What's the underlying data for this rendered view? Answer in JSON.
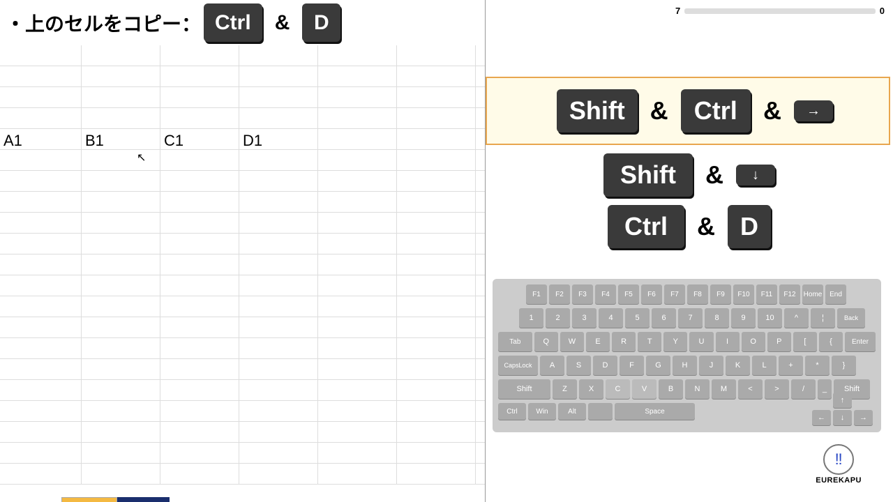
{
  "title": "・上のセルをコピー：",
  "title_keys": {
    "k1": "Ctrl",
    "amp": "&",
    "k2": "D"
  },
  "cells": {
    "a": "A1",
    "b": "B1",
    "c": "C1",
    "d": "D1"
  },
  "progress": {
    "left": "7",
    "right": "0"
  },
  "shortcuts": {
    "row1": {
      "k1": "Shift",
      "amp1": "&",
      "k2": "Ctrl",
      "amp2": "&",
      "k3": "→"
    },
    "row2": {
      "k1": "Shift",
      "amp1": "&",
      "k2": "↓"
    },
    "row3": {
      "k1": "Ctrl",
      "amp1": "&",
      "k2": "D"
    }
  },
  "keyboard": {
    "fn": [
      "F1",
      "F2",
      "F3",
      "F4",
      "F5",
      "F6",
      "F7",
      "F8",
      "F9",
      "F10",
      "F11",
      "F12",
      "Home",
      "End"
    ],
    "num": [
      "1",
      "2",
      "3",
      "4",
      "5",
      "6",
      "7",
      "8",
      "9",
      "10",
      "^",
      "¦"
    ],
    "back": "Back",
    "tab": "Tab",
    "r3": [
      "Q",
      "W",
      "E",
      "R",
      "T",
      "Y",
      "U",
      "I",
      "O",
      "P",
      "[",
      "{"
    ],
    "enter": "Enter",
    "caps": "CapsLock",
    "r4": [
      "A",
      "S",
      "D",
      "F",
      "G",
      "H",
      "J",
      "K",
      "L",
      "+",
      "*",
      "}"
    ],
    "shift": "Shift",
    "r5": [
      "Z",
      "X",
      "C",
      "V",
      "B",
      "N",
      "M",
      "<",
      ">",
      "/",
      "_"
    ],
    "shift2": "Shift",
    "ctrl": "Ctrl",
    "win": "Win",
    "alt": "Alt",
    "space": "Space",
    "arrows": {
      "up": "↑",
      "left": "←",
      "down": "↓",
      "right": "→"
    }
  },
  "logo": {
    "icon": "‼",
    "text": "EUREKAPU"
  }
}
